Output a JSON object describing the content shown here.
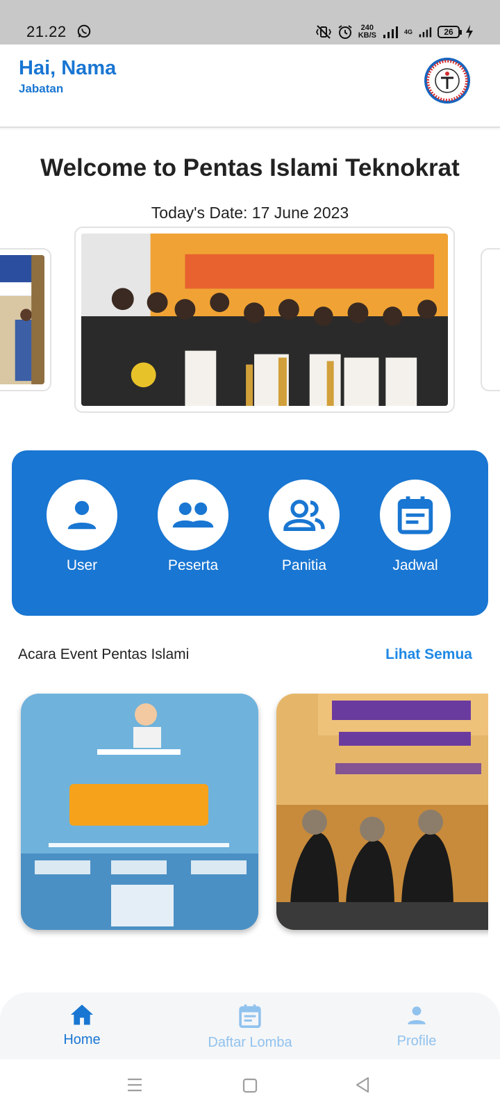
{
  "status_bar": {
    "time": "21.22",
    "speed_value": "240",
    "speed_unit": "KB/S",
    "network": "4G",
    "battery": "26",
    "icons": [
      "whatsapp-icon",
      "vibrate-icon",
      "alarm-icon",
      "signal-icon",
      "battery-icon",
      "charging-icon"
    ]
  },
  "header": {
    "greeting": "Hai, Nama",
    "role": "Jabatan",
    "logo_icon": "university-logo-icon"
  },
  "welcome": {
    "title": "Welcome to Pentas Islami Teknokrat",
    "date": "Today's Date: 17 June 2023"
  },
  "menu": {
    "items": [
      {
        "label": "User",
        "icon": "person-icon"
      },
      {
        "label": "Peserta",
        "icon": "group-icon"
      },
      {
        "label": "Panitia",
        "icon": "people-outline-icon"
      },
      {
        "label": "Jadwal",
        "icon": "calendar-icon"
      }
    ]
  },
  "events": {
    "title": "Acara Event Pentas Islami",
    "see_all": "Lihat Semua"
  },
  "bottom_nav": {
    "items": [
      {
        "label": "Home",
        "icon": "home-icon"
      },
      {
        "label": "Daftar Lomba",
        "icon": "event-list-icon"
      },
      {
        "label": "Profile",
        "icon": "profile-icon"
      }
    ]
  },
  "colors": {
    "primary": "#1976d2",
    "nav_inactive": "#90c2ee",
    "status_bar": "#c8c8c8"
  }
}
